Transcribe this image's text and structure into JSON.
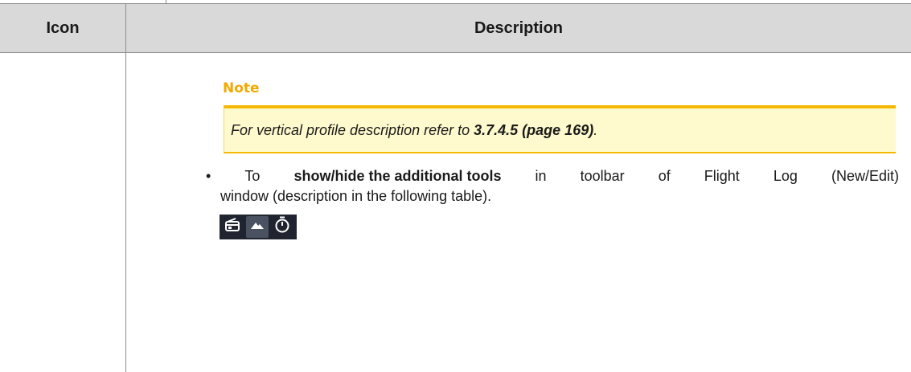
{
  "table": {
    "header": {
      "icon": "Icon",
      "description": "Description"
    }
  },
  "note": {
    "title": "Note",
    "text_prefix": "For vertical profile description refer to ",
    "text_ref": "3.7.4.5 (page 169)",
    "text_suffix": "."
  },
  "bullet": {
    "marker": "•",
    "w1": "To",
    "bold": "show/hide the additional tools",
    "w2": "in",
    "w3": "toolbar",
    "w4": "of",
    "w5": "Flight",
    "w6": "Log",
    "w7": "(New/Edit)",
    "line2": "window (description in the following table)."
  },
  "toolbar": {
    "icons": [
      "radio-icon",
      "mountain-icon",
      "stopwatch-icon"
    ],
    "active_index": 1,
    "background": "#1f2430",
    "active_bg": "#4a5160"
  },
  "colors": {
    "note_accent": "#f5b800",
    "note_title": "#f2a900",
    "note_bg": "#fffacd",
    "header_bg": "#d9d9d9"
  }
}
